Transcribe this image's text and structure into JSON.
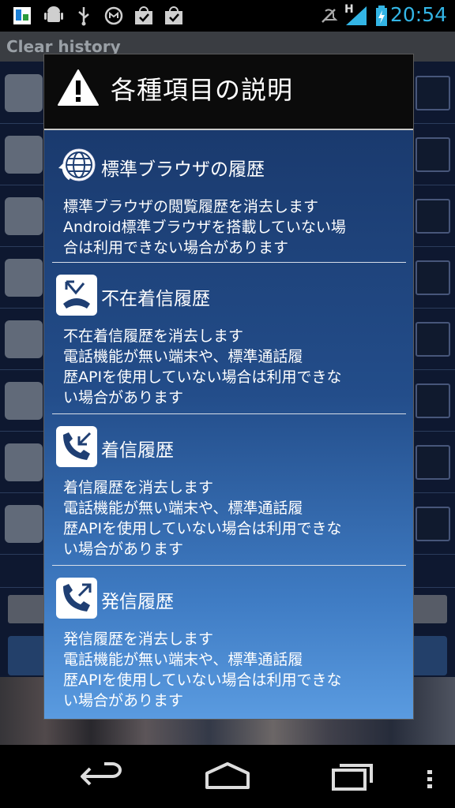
{
  "statusbar": {
    "clock": "20:54",
    "network_label": "H"
  },
  "background_app": {
    "title": "Clear history"
  },
  "dialog": {
    "title": "各種項目の説明",
    "items": [
      {
        "icon": "globe-refresh-icon",
        "title": "標準ブラウザの履歴",
        "description": [
          "標準ブラウザの閲覧履歴を消去します",
          "Android標準ブラウザを搭載していない場",
          "合は利用できない場合があります"
        ]
      },
      {
        "icon": "missed-call-icon",
        "title": "不在着信履歴",
        "description": [
          "不在着信履歴を消去します",
          "電話機能が無い端末や、標準通話履",
          "歴APIを使用していない場合は利用できな",
          "い場合があります"
        ]
      },
      {
        "icon": "incoming-call-icon",
        "title": "着信履歴",
        "description": [
          "着信履歴を消去します",
          "電話機能が無い端末や、標準通話履",
          "歴APIを使用していない場合は利用できな",
          "い場合があります"
        ]
      },
      {
        "icon": "outgoing-call-icon",
        "title": "発信履歴",
        "description": [
          "発信履歴を消去します",
          "電話機能が無い端末や、標準通話履",
          "歴APIを使用していない場合は利用できな",
          "い場合があります"
        ]
      }
    ]
  },
  "colors": {
    "clock": "#33b5e5",
    "dialog_body_top": "#1a3a6e",
    "dialog_body_bottom": "#5a9be0"
  }
}
